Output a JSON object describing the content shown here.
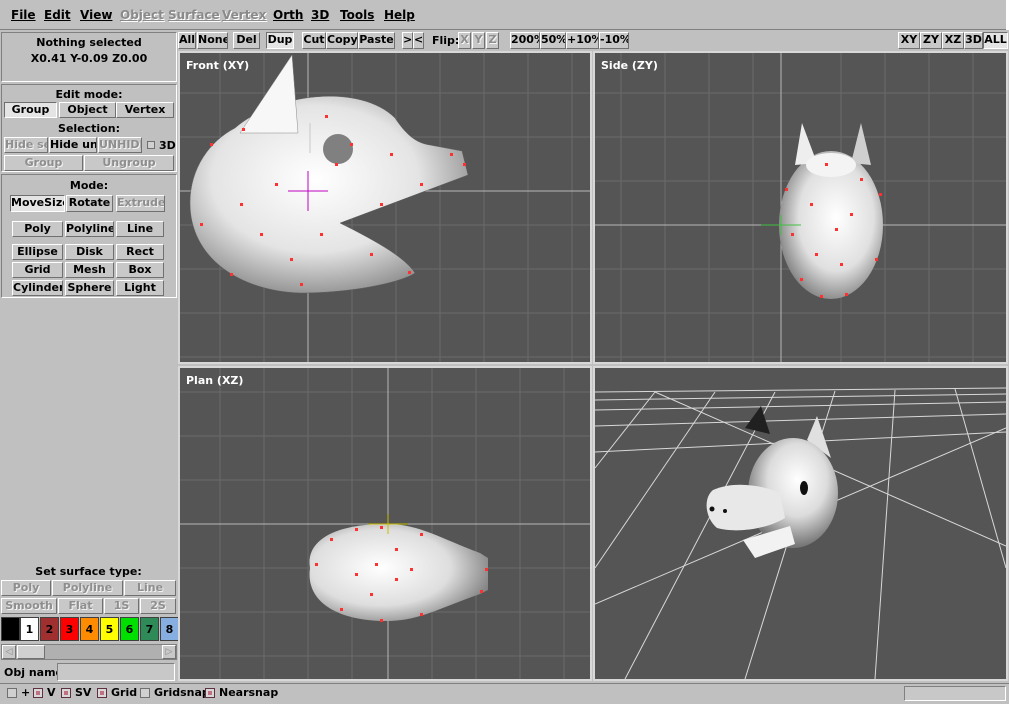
{
  "menu": [
    {
      "label": "File",
      "enabled": true
    },
    {
      "label": "Edit",
      "enabled": true
    },
    {
      "label": "View",
      "enabled": true
    },
    {
      "label": "Object",
      "enabled": false
    },
    {
      "label": "Surface",
      "enabled": false
    },
    {
      "label": "Vertex",
      "enabled": false
    },
    {
      "label": "Orth",
      "enabled": true
    },
    {
      "label": "3D",
      "enabled": true
    },
    {
      "label": "Tools",
      "enabled": true
    },
    {
      "label": "Help",
      "enabled": true
    }
  ],
  "toolbar": {
    "all": "All",
    "none": "None",
    "del": "Del",
    "dup": "Dup",
    "cut": "Cut",
    "copy": "Copy",
    "paste": "Paste",
    "next": ">",
    "prev": "<",
    "flip_label": "Flip:",
    "flip_x": "X",
    "flip_y": "Y",
    "flip_z": "Z",
    "zoom_200": "200%",
    "zoom_50": "50%",
    "zoom_plus10": "+10%",
    "zoom_minus10": "-10%",
    "view_xy": "XY",
    "view_zy": "ZY",
    "view_xz": "XZ",
    "view_3d": "3D",
    "view_all": "ALL"
  },
  "info": {
    "selection": "Nothing selected",
    "coords": "X0.41 Y-0.09 Z0.00"
  },
  "edit_mode": {
    "title": "Edit mode:",
    "group": "Group",
    "object": "Object",
    "vertex": "Vertex"
  },
  "selection": {
    "title": "Selection:",
    "hide_sel": "Hide sel",
    "hide_uns": "Hide uns",
    "unhide": "UNHIDE",
    "three_d": "3D",
    "group": "Group",
    "ungroup": "Ungroup"
  },
  "mode": {
    "title": "Mode:",
    "movesize": "MoveSize",
    "rotate": "Rotate",
    "extrude": "Extrude",
    "poly": "Poly",
    "polyline": "Polyline",
    "line": "Line",
    "ellipse": "Ellipse",
    "disk": "Disk",
    "rect": "Rect",
    "grid": "Grid",
    "mesh": "Mesh",
    "box": "Box",
    "cylinder": "Cylinder",
    "sphere": "Sphere",
    "light": "Light"
  },
  "surface": {
    "title": "Set surface type:",
    "poly": "Poly",
    "polyline": "Polyline",
    "line": "Line",
    "smooth": "Smooth",
    "flat": "Flat",
    "one_s": "1S",
    "two_s": "2S"
  },
  "palette": [
    {
      "label": "",
      "color": "#000000",
      "text": "#ffffff"
    },
    {
      "label": "1",
      "color": "#ffffff",
      "text": "#000000"
    },
    {
      "label": "2",
      "color": "#a03030",
      "text": "#000000"
    },
    {
      "label": "3",
      "color": "#ff0000",
      "text": "#000000"
    },
    {
      "label": "4",
      "color": "#ff8c00",
      "text": "#000000"
    },
    {
      "label": "5",
      "color": "#ffff00",
      "text": "#000000"
    },
    {
      "label": "6",
      "color": "#00e000",
      "text": "#000000"
    },
    {
      "label": "7",
      "color": "#2e8b57",
      "text": "#000000"
    },
    {
      "label": "8",
      "color": "#87aee0",
      "text": "#000000"
    }
  ],
  "obj_name": {
    "label": "Obj name:",
    "value": ""
  },
  "viewports": {
    "front": "Front (XY)",
    "side": "Side (ZY)",
    "plan": "Plan (XZ)"
  },
  "status": {
    "plus": "+",
    "v": "V",
    "sv": "SV",
    "grid": "Grid",
    "gridsnap": "Gridsnap",
    "nearsnap": "Nearsnap"
  },
  "status_checks": {
    "plus": false,
    "v": true,
    "sv": true,
    "grid": true,
    "gridsnap": false,
    "nearsnap": true
  },
  "colors": {
    "viewport_bg": "#555555",
    "grid": "#6a6a6a",
    "axis": "#bbbbbb",
    "vertex": "#ff3030",
    "cursor": "#c000c0"
  }
}
